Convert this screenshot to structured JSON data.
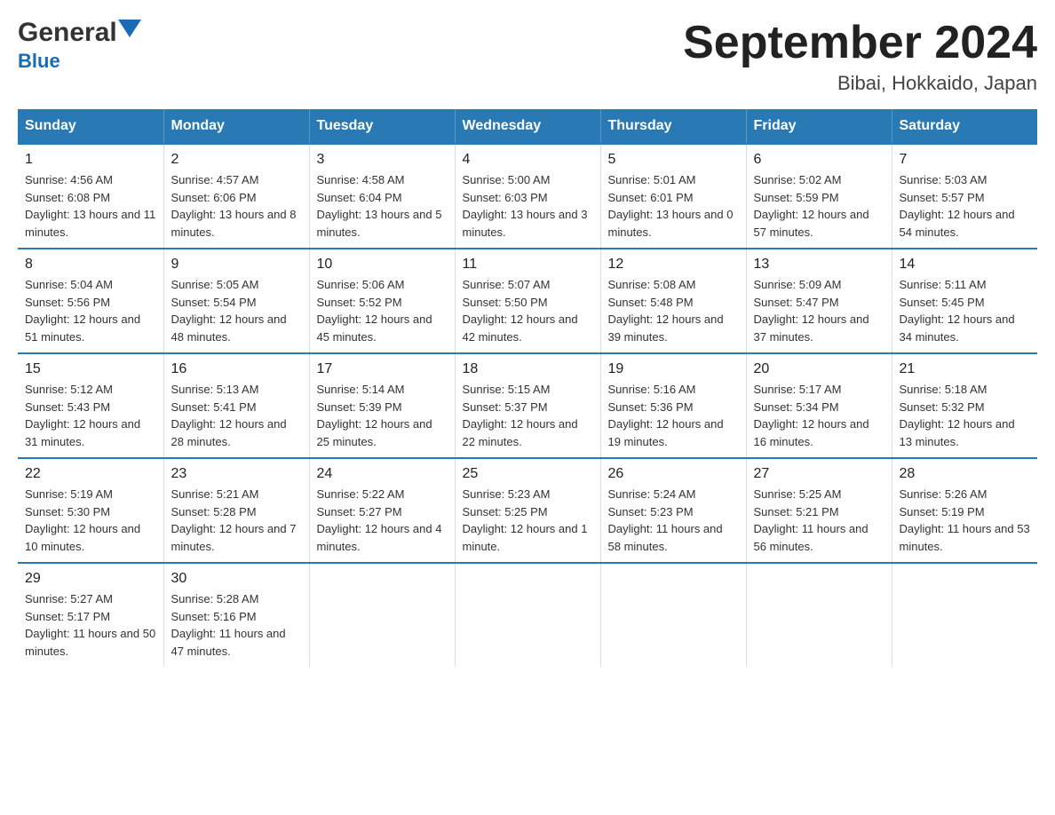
{
  "header": {
    "logo_general": "General",
    "logo_blue": "Blue",
    "title": "September 2024",
    "subtitle": "Bibai, Hokkaido, Japan"
  },
  "days_of_week": [
    "Sunday",
    "Monday",
    "Tuesday",
    "Wednesday",
    "Thursday",
    "Friday",
    "Saturday"
  ],
  "weeks": [
    [
      {
        "day": "1",
        "sunrise": "Sunrise: 4:56 AM",
        "sunset": "Sunset: 6:08 PM",
        "daylight": "Daylight: 13 hours and 11 minutes."
      },
      {
        "day": "2",
        "sunrise": "Sunrise: 4:57 AM",
        "sunset": "Sunset: 6:06 PM",
        "daylight": "Daylight: 13 hours and 8 minutes."
      },
      {
        "day": "3",
        "sunrise": "Sunrise: 4:58 AM",
        "sunset": "Sunset: 6:04 PM",
        "daylight": "Daylight: 13 hours and 5 minutes."
      },
      {
        "day": "4",
        "sunrise": "Sunrise: 5:00 AM",
        "sunset": "Sunset: 6:03 PM",
        "daylight": "Daylight: 13 hours and 3 minutes."
      },
      {
        "day": "5",
        "sunrise": "Sunrise: 5:01 AM",
        "sunset": "Sunset: 6:01 PM",
        "daylight": "Daylight: 13 hours and 0 minutes."
      },
      {
        "day": "6",
        "sunrise": "Sunrise: 5:02 AM",
        "sunset": "Sunset: 5:59 PM",
        "daylight": "Daylight: 12 hours and 57 minutes."
      },
      {
        "day": "7",
        "sunrise": "Sunrise: 5:03 AM",
        "sunset": "Sunset: 5:57 PM",
        "daylight": "Daylight: 12 hours and 54 minutes."
      }
    ],
    [
      {
        "day": "8",
        "sunrise": "Sunrise: 5:04 AM",
        "sunset": "Sunset: 5:56 PM",
        "daylight": "Daylight: 12 hours and 51 minutes."
      },
      {
        "day": "9",
        "sunrise": "Sunrise: 5:05 AM",
        "sunset": "Sunset: 5:54 PM",
        "daylight": "Daylight: 12 hours and 48 minutes."
      },
      {
        "day": "10",
        "sunrise": "Sunrise: 5:06 AM",
        "sunset": "Sunset: 5:52 PM",
        "daylight": "Daylight: 12 hours and 45 minutes."
      },
      {
        "day": "11",
        "sunrise": "Sunrise: 5:07 AM",
        "sunset": "Sunset: 5:50 PM",
        "daylight": "Daylight: 12 hours and 42 minutes."
      },
      {
        "day": "12",
        "sunrise": "Sunrise: 5:08 AM",
        "sunset": "Sunset: 5:48 PM",
        "daylight": "Daylight: 12 hours and 39 minutes."
      },
      {
        "day": "13",
        "sunrise": "Sunrise: 5:09 AM",
        "sunset": "Sunset: 5:47 PM",
        "daylight": "Daylight: 12 hours and 37 minutes."
      },
      {
        "day": "14",
        "sunrise": "Sunrise: 5:11 AM",
        "sunset": "Sunset: 5:45 PM",
        "daylight": "Daylight: 12 hours and 34 minutes."
      }
    ],
    [
      {
        "day": "15",
        "sunrise": "Sunrise: 5:12 AM",
        "sunset": "Sunset: 5:43 PM",
        "daylight": "Daylight: 12 hours and 31 minutes."
      },
      {
        "day": "16",
        "sunrise": "Sunrise: 5:13 AM",
        "sunset": "Sunset: 5:41 PM",
        "daylight": "Daylight: 12 hours and 28 minutes."
      },
      {
        "day": "17",
        "sunrise": "Sunrise: 5:14 AM",
        "sunset": "Sunset: 5:39 PM",
        "daylight": "Daylight: 12 hours and 25 minutes."
      },
      {
        "day": "18",
        "sunrise": "Sunrise: 5:15 AM",
        "sunset": "Sunset: 5:37 PM",
        "daylight": "Daylight: 12 hours and 22 minutes."
      },
      {
        "day": "19",
        "sunrise": "Sunrise: 5:16 AM",
        "sunset": "Sunset: 5:36 PM",
        "daylight": "Daylight: 12 hours and 19 minutes."
      },
      {
        "day": "20",
        "sunrise": "Sunrise: 5:17 AM",
        "sunset": "Sunset: 5:34 PM",
        "daylight": "Daylight: 12 hours and 16 minutes."
      },
      {
        "day": "21",
        "sunrise": "Sunrise: 5:18 AM",
        "sunset": "Sunset: 5:32 PM",
        "daylight": "Daylight: 12 hours and 13 minutes."
      }
    ],
    [
      {
        "day": "22",
        "sunrise": "Sunrise: 5:19 AM",
        "sunset": "Sunset: 5:30 PM",
        "daylight": "Daylight: 12 hours and 10 minutes."
      },
      {
        "day": "23",
        "sunrise": "Sunrise: 5:21 AM",
        "sunset": "Sunset: 5:28 PM",
        "daylight": "Daylight: 12 hours and 7 minutes."
      },
      {
        "day": "24",
        "sunrise": "Sunrise: 5:22 AM",
        "sunset": "Sunset: 5:27 PM",
        "daylight": "Daylight: 12 hours and 4 minutes."
      },
      {
        "day": "25",
        "sunrise": "Sunrise: 5:23 AM",
        "sunset": "Sunset: 5:25 PM",
        "daylight": "Daylight: 12 hours and 1 minute."
      },
      {
        "day": "26",
        "sunrise": "Sunrise: 5:24 AM",
        "sunset": "Sunset: 5:23 PM",
        "daylight": "Daylight: 11 hours and 58 minutes."
      },
      {
        "day": "27",
        "sunrise": "Sunrise: 5:25 AM",
        "sunset": "Sunset: 5:21 PM",
        "daylight": "Daylight: 11 hours and 56 minutes."
      },
      {
        "day": "28",
        "sunrise": "Sunrise: 5:26 AM",
        "sunset": "Sunset: 5:19 PM",
        "daylight": "Daylight: 11 hours and 53 minutes."
      }
    ],
    [
      {
        "day": "29",
        "sunrise": "Sunrise: 5:27 AM",
        "sunset": "Sunset: 5:17 PM",
        "daylight": "Daylight: 11 hours and 50 minutes."
      },
      {
        "day": "30",
        "sunrise": "Sunrise: 5:28 AM",
        "sunset": "Sunset: 5:16 PM",
        "daylight": "Daylight: 11 hours and 47 minutes."
      },
      null,
      null,
      null,
      null,
      null
    ]
  ]
}
